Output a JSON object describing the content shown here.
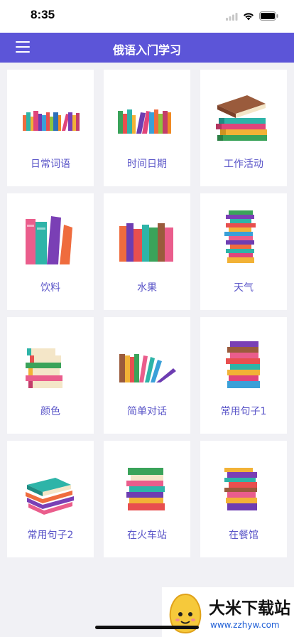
{
  "status": {
    "time": "8:35"
  },
  "header": {
    "title": "俄语入门学习"
  },
  "categories": [
    {
      "label": "日常词语"
    },
    {
      "label": "时间日期"
    },
    {
      "label": "工作活动"
    },
    {
      "label": "饮料"
    },
    {
      "label": "水果"
    },
    {
      "label": "天气"
    },
    {
      "label": "颜色"
    },
    {
      "label": "简单对话"
    },
    {
      "label": "常用句子1"
    },
    {
      "label": "常用句子2"
    },
    {
      "label": "在火车站"
    },
    {
      "label": "在餐馆"
    }
  ],
  "watermark": {
    "title": "大米下载站",
    "url": "www.zzhyw.com"
  },
  "colors": {
    "accent": "#5c55d8",
    "label": "#5a55c8",
    "background": "#f1f1f5"
  }
}
